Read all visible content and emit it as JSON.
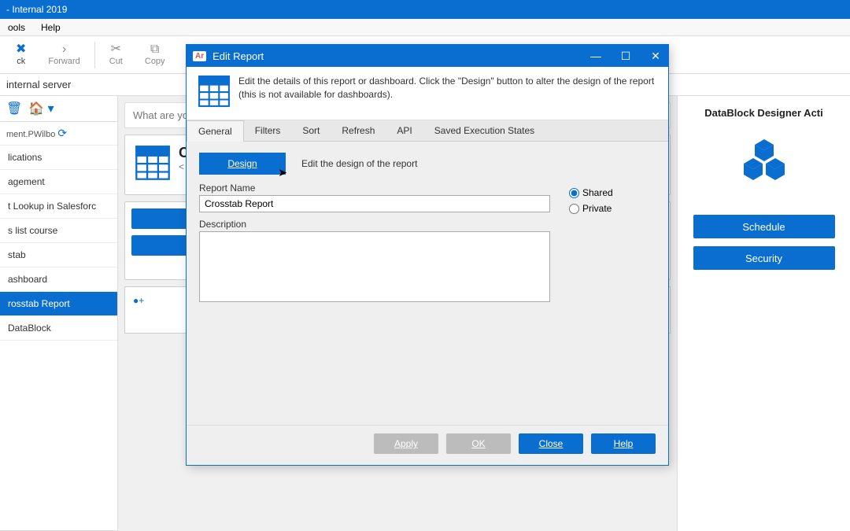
{
  "window": {
    "title": "- Internal 2019"
  },
  "menu": {
    "tools": "ools",
    "help": "Help"
  },
  "toolbar": {
    "back": "ck",
    "forward": "Forward",
    "cut": "Cut",
    "copy": "Copy"
  },
  "subheader": {
    "text": "internal server"
  },
  "left_panel": {
    "headline": "ment.PWilbo",
    "items": [
      "lications",
      "agement",
      "t Lookup in Salesforc",
      "s list course",
      "stab",
      "ashboard",
      "rosstab Report",
      "DataBlock"
    ],
    "selected_index": 6
  },
  "search": {
    "placeholder": "What are you"
  },
  "report_card": {
    "title": "Cr",
    "subtitle": "< d"
  },
  "tiny": {
    "text": "●+"
  },
  "right_panel": {
    "title": "DataBlock Designer Acti",
    "schedule": "Schedule",
    "security": "Security"
  },
  "modal": {
    "title": "Edit Report",
    "description": "Edit the details of this report or dashboard.  Click the \"Design\" button to alter the design of the report (this is not available for dashboards).",
    "tabs": [
      "General",
      "Filters",
      "Sort",
      "Refresh",
      "API",
      "Saved Execution States"
    ],
    "active_tab": 0,
    "design_button": "Design",
    "design_desc": "Edit the design of the report",
    "report_name_label": "Report Name",
    "report_name_value": "Crosstab Report",
    "description_label": "Description",
    "description_value": "",
    "shared_label": "Shared",
    "private_label": "Private",
    "visibility": "shared",
    "buttons": {
      "apply": "Apply",
      "ok": "OK",
      "close": "Close",
      "help": "Help"
    }
  }
}
